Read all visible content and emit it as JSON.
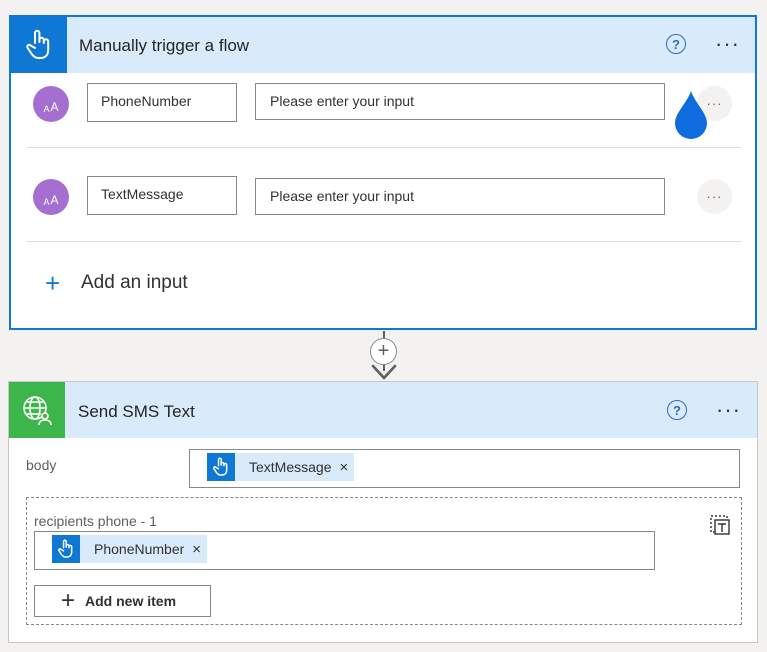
{
  "trigger_card": {
    "title": "Manually trigger a flow",
    "help_glyph": "?",
    "more_glyph": "···",
    "inputs": [
      {
        "name": "PhoneNumber",
        "placeholder": "Please enter your input",
        "type_glyph": "AA",
        "more_glyph": "···"
      },
      {
        "name": "TextMessage",
        "placeholder": "Please enter your input",
        "type_glyph": "AA",
        "more_glyph": "···"
      }
    ],
    "add_input_plus": "+",
    "add_input_label": "Add an input"
  },
  "connector": {
    "plus_glyph": "+"
  },
  "sms_card": {
    "title": "Send SMS Text",
    "help_glyph": "?",
    "more_glyph": "···",
    "body_label": "body",
    "body_token": {
      "label": "TextMessage",
      "close": "×"
    },
    "recipients_label": "recipients phone - 1",
    "recipients_token": {
      "label": "PhoneNumber",
      "close": "×"
    },
    "add_item_plus": "+",
    "add_item_label": "Add new item"
  },
  "colors": {
    "accent": "#0f78d4",
    "header_bg": "#d9ebfb",
    "sms_icon_bg": "#3cb54a",
    "avatar": "#a46fd1"
  },
  "icons": {
    "trigger": "hand-pointer-icon",
    "sms": "globe-person-icon",
    "input_type": "text-type-icon",
    "switch": "switch-to-text-icon",
    "drag": "drop-cursor-icon"
  }
}
